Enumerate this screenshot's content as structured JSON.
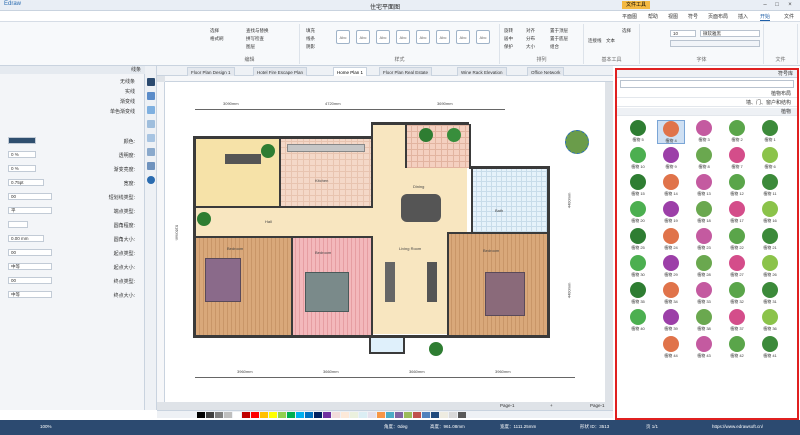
{
  "titlebar": {
    "app": "Edraw",
    "title": "住宅平面图",
    "context_tab": "文件工具",
    "min": "–",
    "max": "□",
    "close": "×"
  },
  "menu": {
    "tabs": [
      "文件",
      "开始",
      "插入",
      "页面布局",
      "符号",
      "视图",
      "帮助",
      "平面图"
    ],
    "active": "开始"
  },
  "ribbon": {
    "groups": [
      "文件",
      "字体",
      "基本工具",
      "排列",
      "样式",
      "编辑"
    ],
    "font_name": "微软雅黑",
    "font_size": "10",
    "tools": {
      "select": "选择",
      "text": "文本",
      "connector": "连接线"
    },
    "arrange": [
      "置于顶层",
      "置于底层",
      "组合",
      "对齐",
      "分布",
      "大小",
      "旋转",
      "居中",
      "保护"
    ],
    "style_labels": [
      "Abc",
      "Abc",
      "Abc",
      "Abc",
      "Abc",
      "Abc",
      "Abc",
      "Abc"
    ],
    "style_opts": [
      "填充",
      "线条",
      "阴影"
    ],
    "edit": [
      "查找与替换",
      "拼写检查",
      "图层",
      "选择",
      "格式刷"
    ]
  },
  "leftpanel": {
    "title": "线条",
    "options": [
      "无线条",
      "实线",
      "渐变线",
      "单色渐变线"
    ],
    "props": [
      {
        "label": "颜色:",
        "value": ""
      },
      {
        "label": "透明度:",
        "value": "0 %"
      },
      {
        "label": "渐变亮度:",
        "value": "0 %"
      },
      {
        "label": "宽度:",
        "value": "0.75pt"
      },
      {
        "label": "短划线类型:",
        "value": "00"
      },
      {
        "label": "端点类型:",
        "value": "平"
      },
      {
        "label": "圆角程度:",
        "value": ""
      },
      {
        "label": "圆角大小:",
        "value": "0.00 mm"
      },
      {
        "label": "起点类型:",
        "value": "00"
      },
      {
        "label": "起点大小:",
        "value": "中等"
      },
      {
        "label": "终点类型:",
        "value": "00"
      },
      {
        "label": "终点大小:",
        "value": "中等"
      }
    ]
  },
  "doctabs": [
    "Office Network",
    "Wine Rack Elevation",
    "Floor Plan Real Estate",
    "Home Plan 1",
    "Hotel Fire Escape Plan",
    "Floor Plan Design 1"
  ],
  "doctab_active": "Home Plan 1",
  "plan": {
    "dims_top": [
      "3090mm",
      "4720mm",
      "3690mm"
    ],
    "dims_bottom": [
      "3960mm",
      "3660mm",
      "3660mm",
      "3960mm"
    ],
    "dims_left": [
      "6160mm"
    ],
    "dims_right": [
      "4400mm",
      "4400mm"
    ],
    "room_labels": [
      "Kitchen",
      "Dining",
      "Living Room",
      "Bedroom",
      "Bedroom",
      "Bedroom",
      "Bath",
      "Hall"
    ]
  },
  "library": {
    "title": "符号库",
    "categories": [
      "植物布局",
      "墙、门、窗户和结构",
      "植物"
    ],
    "plants": [
      "植物 1",
      "植物 2",
      "植物 3",
      "植物 4",
      "植物 5",
      "植物 6",
      "植物 7",
      "植物 8",
      "植物 9",
      "植物 10",
      "植物 11",
      "植物 12",
      "植物 13",
      "植物 14",
      "植物 15",
      "植物 16",
      "植物 17",
      "植物 18",
      "植物 19",
      "植物 20",
      "植物 21",
      "植物 22",
      "植物 23",
      "植物 24",
      "植物 25",
      "植物 26",
      "植物 27",
      "植物 28",
      "植物 29",
      "植物 30",
      "植物 31",
      "植物 32",
      "植物 33",
      "植物 34",
      "植物 35",
      "植物 36",
      "植物 37",
      "植物 38",
      "植物 39",
      "植物 40",
      "植物 41",
      "植物 42",
      "植物 43",
      "植物 44"
    ],
    "selected": "植物 4",
    "colors": [
      "#3c8a3a",
      "#5aa54a",
      "#c45aa0",
      "#e0734a",
      "#2e7d32",
      "#8bc34a",
      "#d44d8a",
      "#6aa84f",
      "#9c3fa8",
      "#4caf50"
    ]
  },
  "pagebar": {
    "page": "Page-1",
    "add": "+",
    "current": "Page-1"
  },
  "statusbar": {
    "url": "https://www.edrawsoft.cn/",
    "page_info": "页 1/1",
    "shape_id": "形状 ID：3513",
    "width": "宽度：1111.25mm",
    "height": "高度：961.08mm",
    "angle": "角度：0deg",
    "zoom": "100%"
  },
  "palette_colors": [
    "#000000",
    "#404040",
    "#7f7f7f",
    "#bfbfbf",
    "#ffffff",
    "#c00000",
    "#ff0000",
    "#ffc000",
    "#ffff00",
    "#92d050",
    "#00b050",
    "#00b0f0",
    "#0070c0",
    "#002060",
    "#7030a0",
    "#f2dcdb",
    "#fde9d9",
    "#ebf1de",
    "#dbeef4",
    "#e5e0ec",
    "#f79646",
    "#4bacc6",
    "#8064a2",
    "#9bbb59",
    "#c0504d",
    "#4f81bd",
    "#1f497d",
    "#eeece1",
    "#d9d9d9",
    "#595959"
  ]
}
